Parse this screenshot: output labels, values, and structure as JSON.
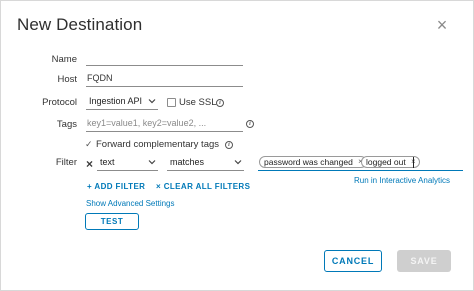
{
  "dialog": {
    "title": "New Destination",
    "close_glyph": "×"
  },
  "form": {
    "name": {
      "label": "Name",
      "value": ""
    },
    "host": {
      "label": "Host",
      "value": "FQDN"
    },
    "protocol": {
      "label": "Protocol",
      "selected": "Ingestion API",
      "use_ssl_label": "Use SSL",
      "use_ssl_checked": false
    },
    "tags": {
      "label": "Tags",
      "placeholder": "key1=value1, key2=value2, ..."
    },
    "forward_tags": {
      "label": "Forward complementary tags",
      "checked": true
    },
    "filter": {
      "label": "Filter",
      "remove_glyph": "×",
      "field_select": "text",
      "operator_select": "matches",
      "chips": [
        "password was changed",
        "logged out"
      ],
      "chip_remove_glyph": "×",
      "run_link": "Run in Interactive Analytics",
      "add_filter": "+ ADD FILTER",
      "clear_filters": "× CLEAR ALL FILTERS"
    },
    "advanced_link": "Show Advanced Settings",
    "test_button": "TEST"
  },
  "footer": {
    "cancel_button": "CANCEL",
    "save_button": "SAVE"
  },
  "icons": {
    "info": "info-icon",
    "check": "checkmark-icon",
    "chevron": "chevron-down-icon"
  },
  "colors": {
    "accent": "#0079b8",
    "disabled": "#cfcfcf"
  }
}
